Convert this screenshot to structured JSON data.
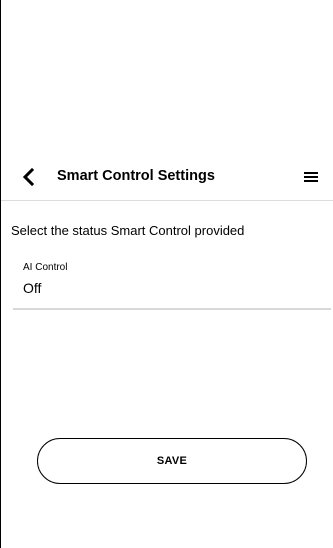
{
  "header": {
    "title": "Smart Control Settings",
    "back_icon": "chevron-left-icon",
    "menu_icon": "hamburger-menu-icon"
  },
  "content": {
    "instruction": "Select the status Smart Control provided",
    "ai_control": {
      "label": "AI Control",
      "value": "Off"
    },
    "save_label": "SAVE"
  }
}
